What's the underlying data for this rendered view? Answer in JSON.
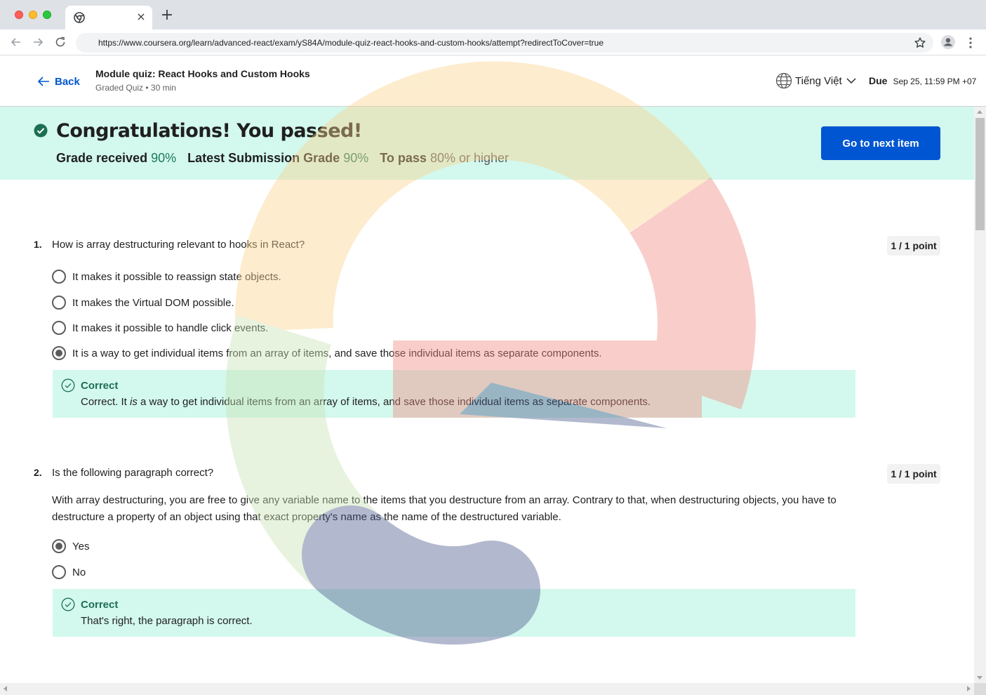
{
  "browser": {
    "tab_close": "×",
    "new_tab": "+",
    "url": "https://www.coursera.org/learn/advanced-react/exam/yS84A/module-quiz-react-hooks-and-custom-hooks/attempt?redirectToCover=true"
  },
  "header": {
    "back_label": "Back",
    "title": "Module quiz: React Hooks and Custom Hooks",
    "subtitle": "Graded Quiz • 30 min",
    "language": "Tiếng Việt",
    "due_label": "Due",
    "due_value": "Sep 25, 11:59 PM +07"
  },
  "banner": {
    "title": "Congratulations! You passed!",
    "grade_received_label": "Grade received",
    "grade_received_value": "90%",
    "latest_label": "Latest Submission Grade",
    "latest_value": "90%",
    "to_pass_label": "To pass",
    "to_pass_value": "80% or higher",
    "next_button": "Go to next item"
  },
  "questions": [
    {
      "number": "1.",
      "text": "How is array destructuring relevant to hooks in React?",
      "points": "1 / 1 point",
      "options": [
        "It makes it possible to reassign state objects.",
        "It makes the Virtual DOM possible.",
        "It makes it possible to handle click events.",
        "It is a way to get individual items from an array of items, and save those individual items as separate components."
      ],
      "selected_index": 3,
      "feedback_title": "Correct",
      "feedback_pre": "Correct. It ",
      "feedback_em": "is",
      "feedback_post": " a way to get individual items from an array of items, and save those individual items as separate components."
    },
    {
      "number": "2.",
      "text": "Is the following paragraph correct?",
      "points": "1 / 1 point",
      "paragraph": "With array destructuring, you are free to give any variable name to the items that you destructure from an array. Contrary to that, when destructuring objects, you have to destructure a property of an object using that exact property's name as the name of the destructured variable.",
      "options": [
        "Yes",
        "No"
      ],
      "selected_index": 0,
      "feedback_title": "Correct",
      "feedback_text": "That's right, the paragraph is correct."
    }
  ],
  "colors": {
    "brand_blue": "#0056d2",
    "success_bg": "#d3f8ed",
    "success_green": "#1d6f53"
  }
}
